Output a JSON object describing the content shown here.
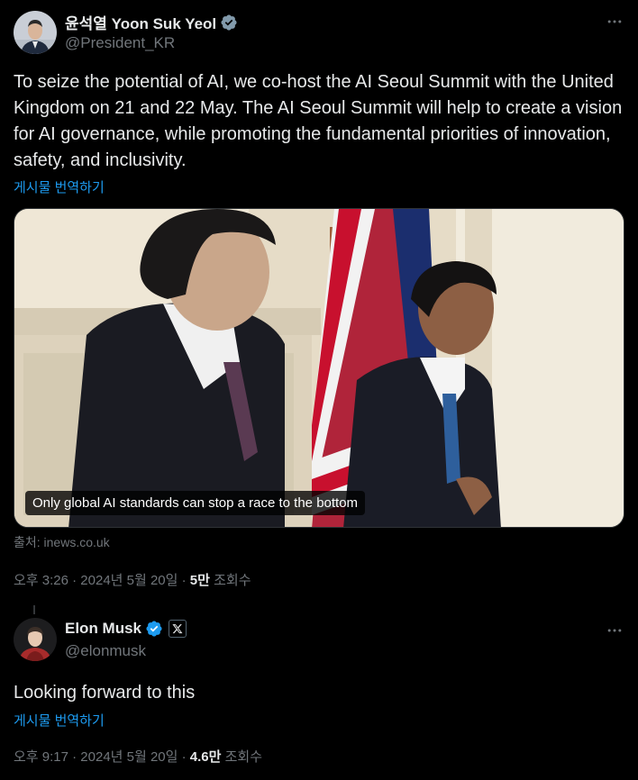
{
  "main_tweet": {
    "display_name": "윤석열 Yoon Suk Yeol",
    "handle": "@President_KR",
    "more_icon": "more-horizontal-icon",
    "text": "To seize the potential of AI, we co-host the AI Seoul Summit with the United Kingdom on 21 and 22 May. The AI Seoul Summit will help to create a vision for AI governance, while promoting the fundamental priorities of innovation, safety, and inclusivity.",
    "translate_label": "게시물 번역하기",
    "media_caption": "Only global AI standards can stop a race to the bottom",
    "source": "출처: inews.co.uk",
    "time": "오후 3:26 · 2024년 5월 20일 · ",
    "views_count": "5만",
    "views_label": " 조회수"
  },
  "reply_tweet": {
    "display_name": "Elon Musk",
    "handle": "@elonmusk",
    "affiliate_icon": "x-logo-icon",
    "more_icon": "more-horizontal-icon",
    "text": "Looking forward to this",
    "translate_label": "게시물 번역하기",
    "time": "오후 9:17 · 2024년 5월 20일 · ",
    "views_count": "4.6만",
    "views_label": " 조회수"
  },
  "colors": {
    "background": "#000000",
    "text": "#e7e9ea",
    "secondary": "#71767b",
    "link": "#1d9bf0",
    "verified_blue": "#1d9bf0",
    "verified_gray": "#829aab"
  }
}
